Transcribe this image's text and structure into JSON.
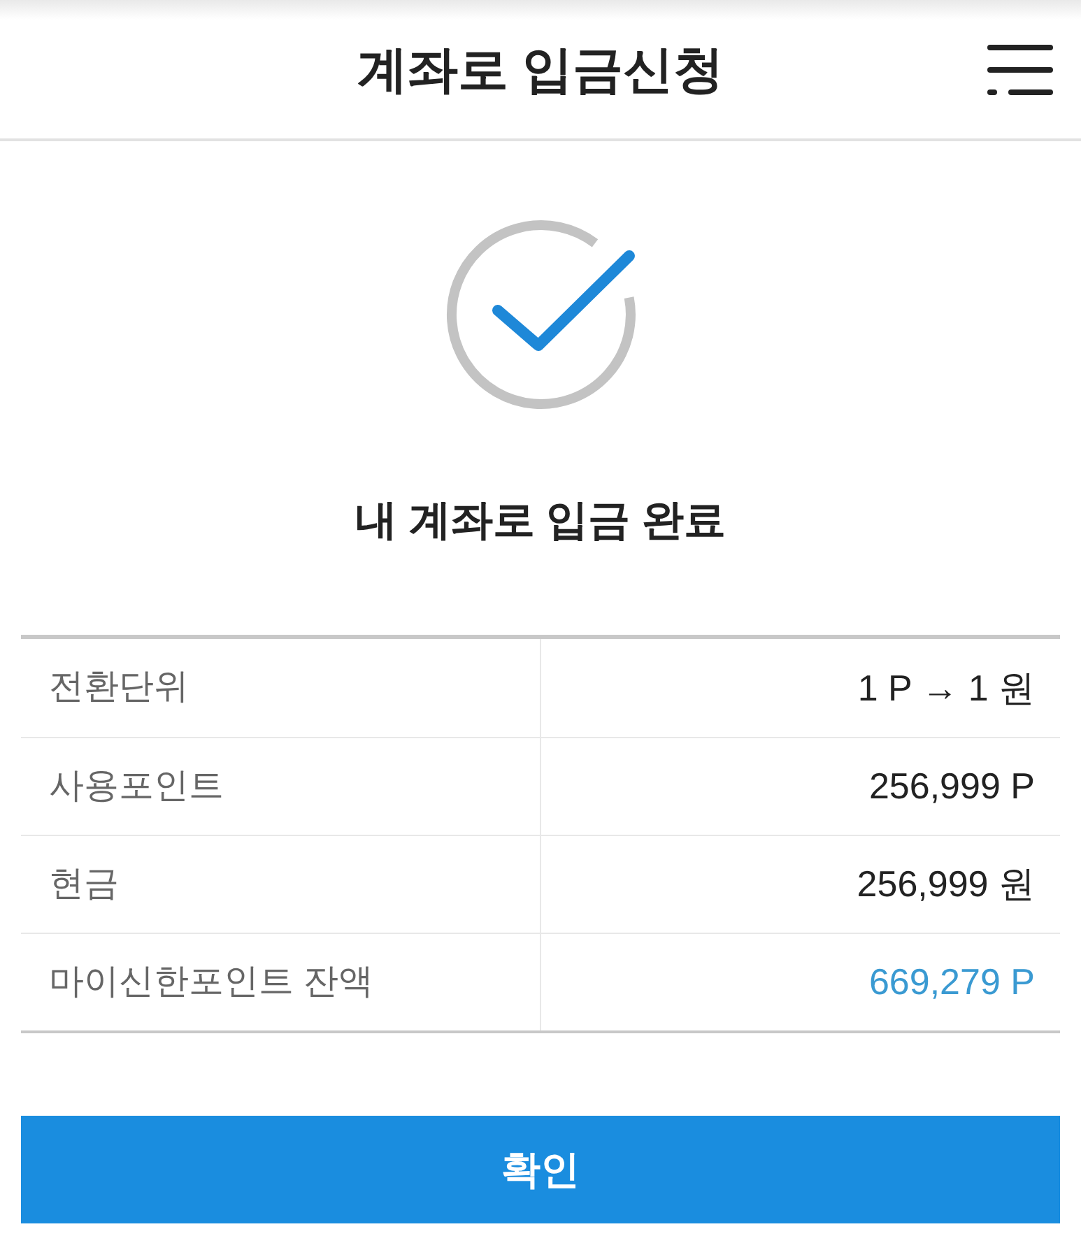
{
  "header": {
    "title": "계좌로 입금신청"
  },
  "result": {
    "message": "내 계좌로 입금 완료"
  },
  "details": [
    {
      "label": "전환단위",
      "value": "1 P → 1 원",
      "highlighted": false
    },
    {
      "label": "사용포인트",
      "value": "256,999 P",
      "highlighted": false
    },
    {
      "label": "현금",
      "value": "256,999 원",
      "highlighted": false
    },
    {
      "label": "마이신한포인트 잔액",
      "value": "669,279 P",
      "highlighted": true
    }
  ],
  "buttons": [
    {
      "label": "확인"
    }
  ]
}
